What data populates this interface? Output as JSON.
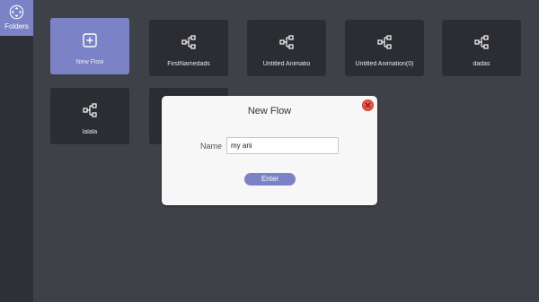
{
  "sidebar": {
    "folders_label": "Folders",
    "folders_icon": "folders-logo-icon"
  },
  "tiles": [
    {
      "label": "New Flow",
      "icon": "plus-square-icon"
    },
    {
      "label": "FirstNamedads",
      "icon": "flow-icon"
    },
    {
      "label": "Untitled Animatio",
      "icon": "flow-icon"
    },
    {
      "label": "Untitled Animation(0)",
      "icon": "flow-icon"
    },
    {
      "label": "dadas",
      "icon": "flow-icon"
    },
    {
      "label": "lalala",
      "icon": "flow-icon"
    }
  ],
  "dialog": {
    "title": "New Flow",
    "name_label": "Name",
    "name_value": "my ani",
    "enter_label": "Enter",
    "close_icon": "close-icon"
  },
  "colors": {
    "accent": "#7c82c6",
    "background": "#3f4149",
    "sidebar": "#2f3037",
    "tile": "#2c2d32",
    "dialog": "#f7f7f7",
    "close": "#e8584c"
  }
}
